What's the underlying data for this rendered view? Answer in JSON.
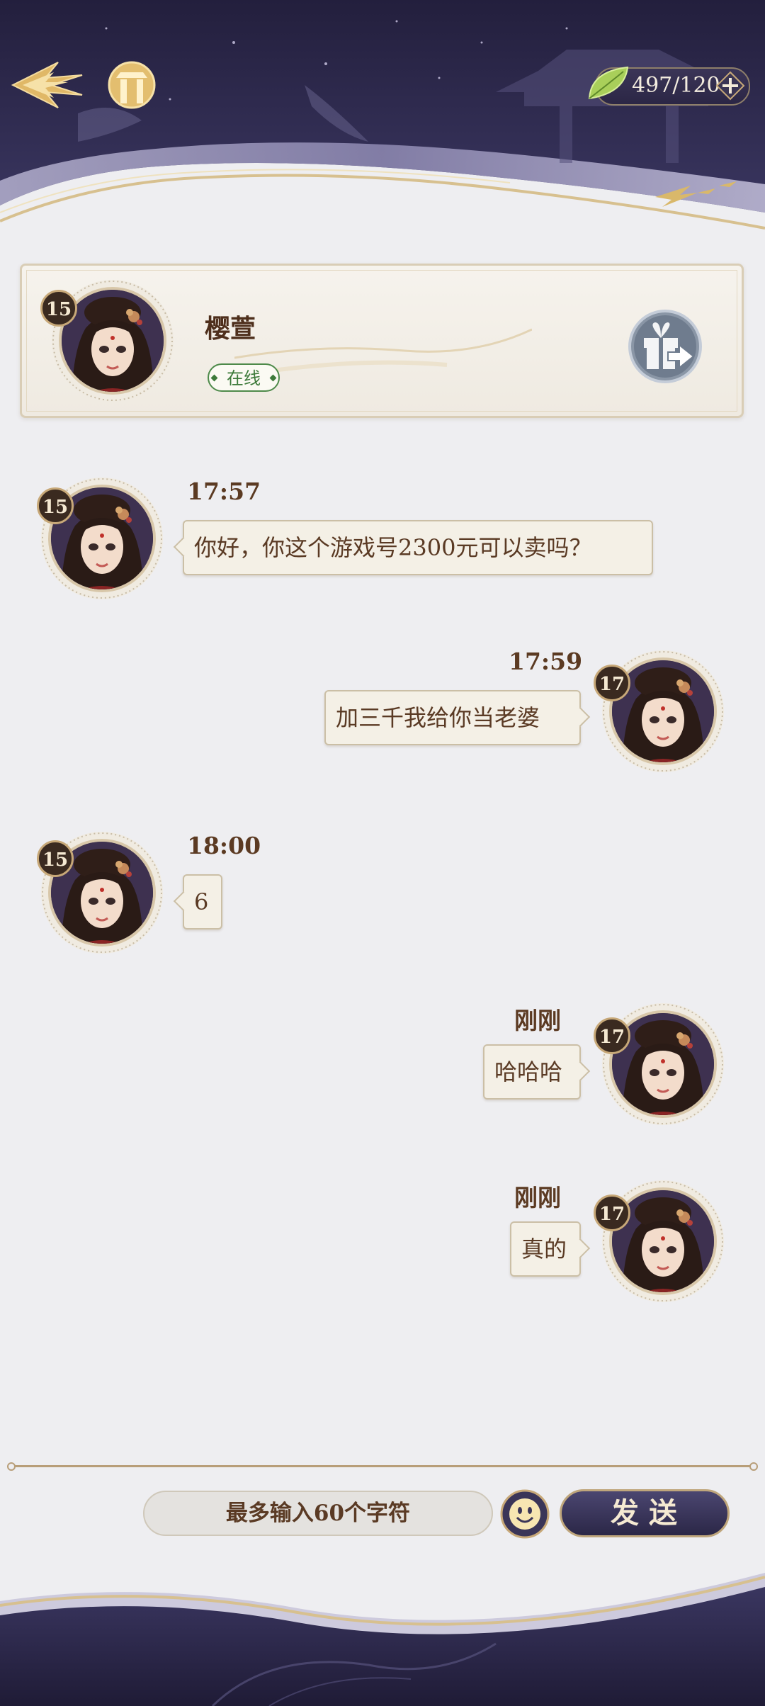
{
  "header": {
    "back_icon": "back-arrow-icon",
    "home_icon": "home-icon",
    "currency": {
      "icon": "leaf-icon",
      "amount": "497/120",
      "plus_icon": "plus-icon"
    }
  },
  "profile": {
    "name": "樱萱",
    "level": "15",
    "status": "在线",
    "gift_icon": "gift-send-icon"
  },
  "messages": [
    {
      "side": "left",
      "level": "15",
      "time": "17:57",
      "text": "你好，你这个游戏号2300元可以卖吗？"
    },
    {
      "side": "right",
      "level": "17",
      "time": "17:59",
      "text": "加三千我给你当老婆"
    },
    {
      "side": "left",
      "level": "15",
      "time": "18:00",
      "text": "6"
    },
    {
      "side": "right",
      "level": "17",
      "time": "刚刚",
      "text": "哈哈哈"
    },
    {
      "side": "right",
      "level": "17",
      "time": "刚刚",
      "text": "真的"
    }
  ],
  "input": {
    "value": "",
    "placeholder": "最多输入60个字符",
    "emoji_icon": "emoji-icon",
    "send_label": "发送"
  },
  "colors": {
    "header_navy": "#2e2a4d",
    "accent_gold": "#c7a878",
    "online_green": "#3d7a3a",
    "bubble_bg": "#f4f0e6",
    "text_brown": "#5a3a24"
  }
}
